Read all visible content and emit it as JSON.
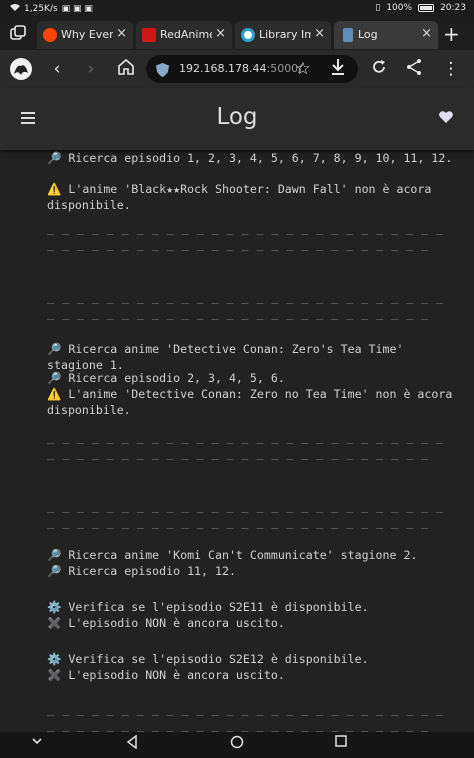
{
  "status": {
    "speed": "1,25K/s",
    "battery": "100%",
    "time": "20:23"
  },
  "tabs": [
    {
      "title": "Why Every",
      "close": "×",
      "color": "#ff4500"
    },
    {
      "title": "RedAnime",
      "close": "×",
      "color": "#d01818"
    },
    {
      "title": "Library Im",
      "close": "×",
      "color": "#ffffff"
    },
    {
      "title": "Log",
      "close": "×",
      "color": "#5f8fb8"
    }
  ],
  "newtab": "+",
  "browser": {
    "url_host": "192.168.178.44",
    "url_port": ":5000/",
    "back": "‹",
    "forward": "›"
  },
  "app": {
    "title": "Log"
  },
  "log": {
    "l1": "🔎 Ricerca episodio 1, 2, 3, 4, 5, 6, 7, 8, 9, 10, 11, 12.",
    "l2": "⚠️ L'anime 'Black★★Rock Shooter: Dawn Fall' non è acora disponibile.",
    "l3": "🔎 Ricerca anime 'Detective Conan: Zero's Tea Time' stagione 1.",
    "l4": "🔎 Ricerca episodio 2, 3, 4, 5, 6.",
    "l5": "⚠️ L'anime 'Detective Conan: Zero no Tea Time' non è acora disponibile.",
    "l6": "🔎 Ricerca anime 'Komi Can't Communicate' stagione 2.",
    "l7": "🔎 Ricerca episodio 11, 12.",
    "l8": "⚙️ Verifica se l'episodio S2E11 è disponibile.",
    "l9": "✖️ L'episodio NON è ancora uscito.",
    "l10": "⚙️ Verifica se l'episodio S2E12 è disponibile.",
    "l11": "✖️ L'episodio NON è ancora uscito.",
    "separator": "_ _ _ _ _ _ _ _ _ _ _ _ _ _ _ _ _ _ _ _ _ _ _ _ _ _ _ _ _ _ _ _ _ _ _ _ _ _ _ _ _ _ _ _ _ _ _ _ _ _ _ _ _"
  }
}
